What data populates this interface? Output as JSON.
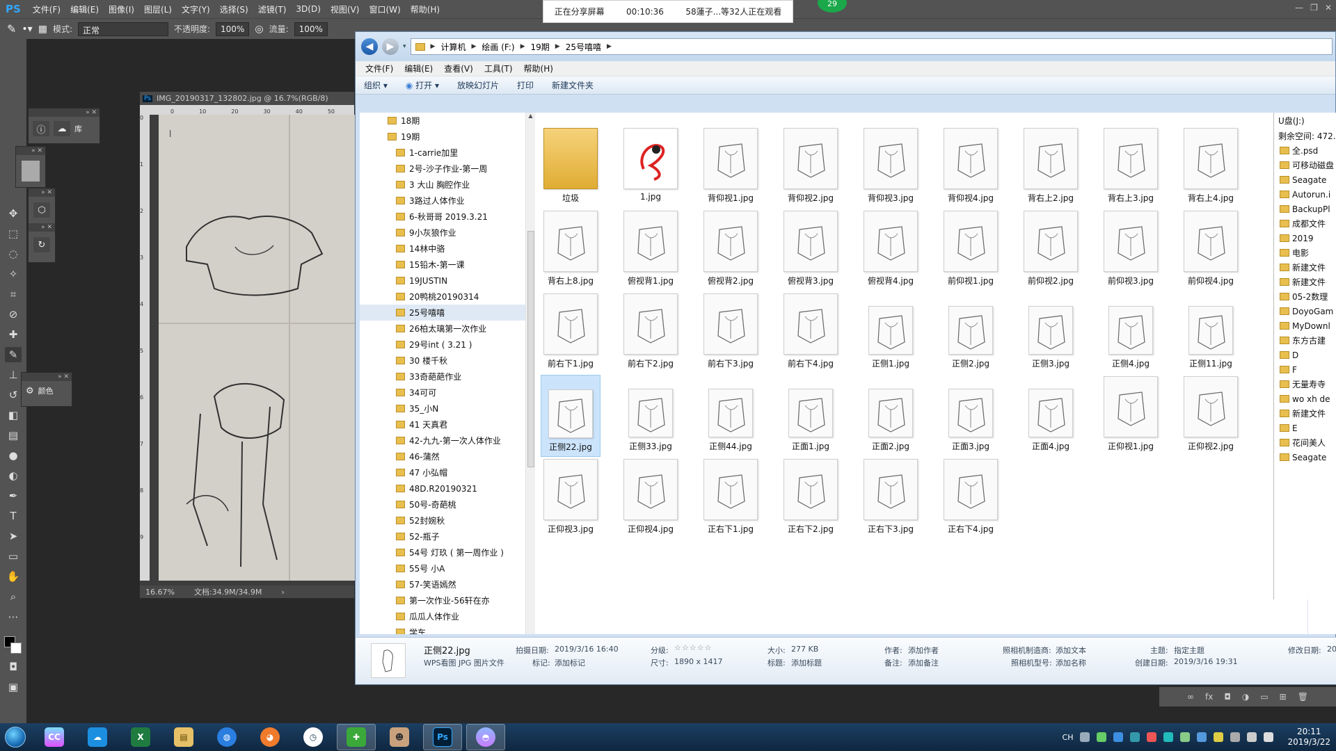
{
  "ps": {
    "logo": "PS",
    "menu": [
      "文件(F)",
      "编辑(E)",
      "图像(I)",
      "图层(L)",
      "文字(Y)",
      "选择(S)",
      "滤镜(T)",
      "3D(D)",
      "视图(V)",
      "窗口(W)",
      "帮助(H)"
    ],
    "options": {
      "mode_label": "模式:",
      "mode_value": "正常",
      "opacity_label": "不透明度:",
      "opacity_value": "100%",
      "flow_label": "流量:",
      "flow_value": "100%"
    },
    "panels": {
      "library_label": "库",
      "color_label": "颜色"
    },
    "document": {
      "tab_title": "IMG_20190317_132802.jpg @ 16.7%(RGB/8)",
      "ruler_h": [
        "0",
        "10",
        "20",
        "30",
        "40",
        "50"
      ],
      "ruler_v": [
        "0",
        "1",
        "2",
        "3",
        "4",
        "5",
        "6",
        "7",
        "8",
        "9"
      ],
      "zoom": "16.67%",
      "doc_size": "文档:34.9M/34.9M"
    },
    "layers_strip": [
      "∞",
      "fx",
      "◘",
      "◑",
      "▭",
      "⊞",
      "🗑"
    ]
  },
  "share": {
    "status": "正在分享屏幕",
    "time": "00:10:36",
    "viewers": "58蓮子...等32人正在观看",
    "badge": "29"
  },
  "explorer": {
    "breadcrumb": [
      "计算机",
      "绘画 (F:)",
      "19期",
      "25号嘻嘻"
    ],
    "menu": [
      "文件(F)",
      "编辑(E)",
      "查看(V)",
      "工具(T)",
      "帮助(H)"
    ],
    "toolbar": [
      "组织 ▾",
      "打开 ▾",
      "放映幻灯片",
      "打印",
      "新建文件夹"
    ],
    "nav_top": [
      "18期",
      "19期"
    ],
    "nav_folders": [
      "1-carrie加里",
      "2号-沙子作业-第一周",
      "3 大山 胸腔作业",
      "3路过人体作业",
      "6-秋哥哥 2019.3.21",
      "9小灰狼作业",
      "14林中骆",
      "15铅木-第一课",
      "19JUSTIN",
      "20鸭桃20190314",
      "25号嘻嘻",
      "26柏太璃第一次作业",
      "29号int ( 3.21 )",
      "30 楼千秋",
      "33奇葩葩作业",
      "34可可",
      "35_小N",
      "41 天真君",
      "42-九九-第一次人体作业",
      "46-蒲然",
      "47 小弘帽",
      "48D.R20190321",
      "50号-奇葩桃",
      "52封婉秋",
      "52-瓶子",
      "54号 灯玖 ( 第一周作业 )",
      "55号 小A",
      "57-笑语嫣然",
      "第一次作业-56轩在亦",
      "瓜瓜人体作业",
      "学车"
    ],
    "files": [
      "垃圾",
      "1.jpg",
      "背仰视1.jpg",
      "背仰视2.jpg",
      "背仰视3.jpg",
      "背仰视4.jpg",
      "背右上2.jpg",
      "背右上3.jpg",
      "背右上4.jpg",
      "背右上8.jpg",
      "俯视背1.jpg",
      "俯视背2.jpg",
      "俯视背3.jpg",
      "俯视背4.jpg",
      "前仰视1.jpg",
      "前仰视2.jpg",
      "前仰视3.jpg",
      "前仰视4.jpg",
      "前右下1.jpg",
      "前右下2.jpg",
      "前右下3.jpg",
      "前右下4.jpg",
      "正侧1.jpg",
      "正侧2.jpg",
      "正侧3.jpg",
      "正侧4.jpg",
      "正侧11.jpg",
      "正侧22.jpg",
      "正侧33.jpg",
      "正侧44.jpg",
      "正面1.jpg",
      "正面2.jpg",
      "正面3.jpg",
      "正面4.jpg",
      "正仰视1.jpg",
      "正仰视2.jpg",
      "正仰视3.jpg",
      "正仰视4.jpg",
      "正右下1.jpg",
      "正右下2.jpg",
      "正右下3.jpg",
      "正右下4.jpg"
    ],
    "details": {
      "name": "正侧22.jpg",
      "type": "WPS看图 JPG 图片文件",
      "taken_label": "拍摄日期:",
      "taken_value": "2019/3/16 16:40",
      "tags_label": "标记:",
      "tags_value": "添加标记",
      "rating_label": "分级:",
      "rating_value": "☆☆☆☆☆",
      "dims_label": "尺寸:",
      "dims_value": "1890 x 1417",
      "size_label": "大小:",
      "size_value": "277 KB",
      "title_label": "标题:",
      "title_value": "添加标题",
      "author_label": "作者:",
      "author_value": "添加作者",
      "comments_label": "备注:",
      "comments_value": "添加备注",
      "camera_maker_label": "照相机制造商:",
      "camera_maker_value": "添加文本",
      "camera_model_label": "照相机型号:",
      "camera_model_value": "添加名称",
      "subject_label": "主题:",
      "subject_value": "指定主题",
      "created_label": "创建日期:",
      "created_value": "2019/3/16 19:31",
      "modified_label": "修改日期:",
      "modified_value": "20"
    }
  },
  "udisk": {
    "title": "U盘(J:)",
    "free": "剩余空间: 472.",
    "items": [
      "全.psd",
      "可移动磁盘",
      "Seagate",
      "Autorun.i",
      "BackupPl",
      "成都文件",
      "2019",
      "电影",
      "新建文件",
      "新建文件",
      "05-2数理",
      "DoyoGam",
      "MyDownl",
      "东方古建",
      "D",
      "F",
      "无量寿寺",
      "wo xh de",
      "新建文件",
      "E",
      "花间美人",
      "Seagate"
    ]
  },
  "taskbar": {
    "apps": [
      "start",
      "ps-cc",
      "qq-tim",
      "excel",
      "explorer",
      "paint",
      "huohu",
      "clock-app",
      "360",
      "avatar",
      "photoshop",
      "video-app"
    ],
    "tray_lang": "CH",
    "time": "20:11",
    "date": "2019/3/22"
  },
  "colors": {
    "ps_dark": "#535353",
    "explorer_frame": "#cfe0f2",
    "taskbar": "#1c3f63",
    "selection": "#cce4fb",
    "folder": "#e8bf4f"
  }
}
